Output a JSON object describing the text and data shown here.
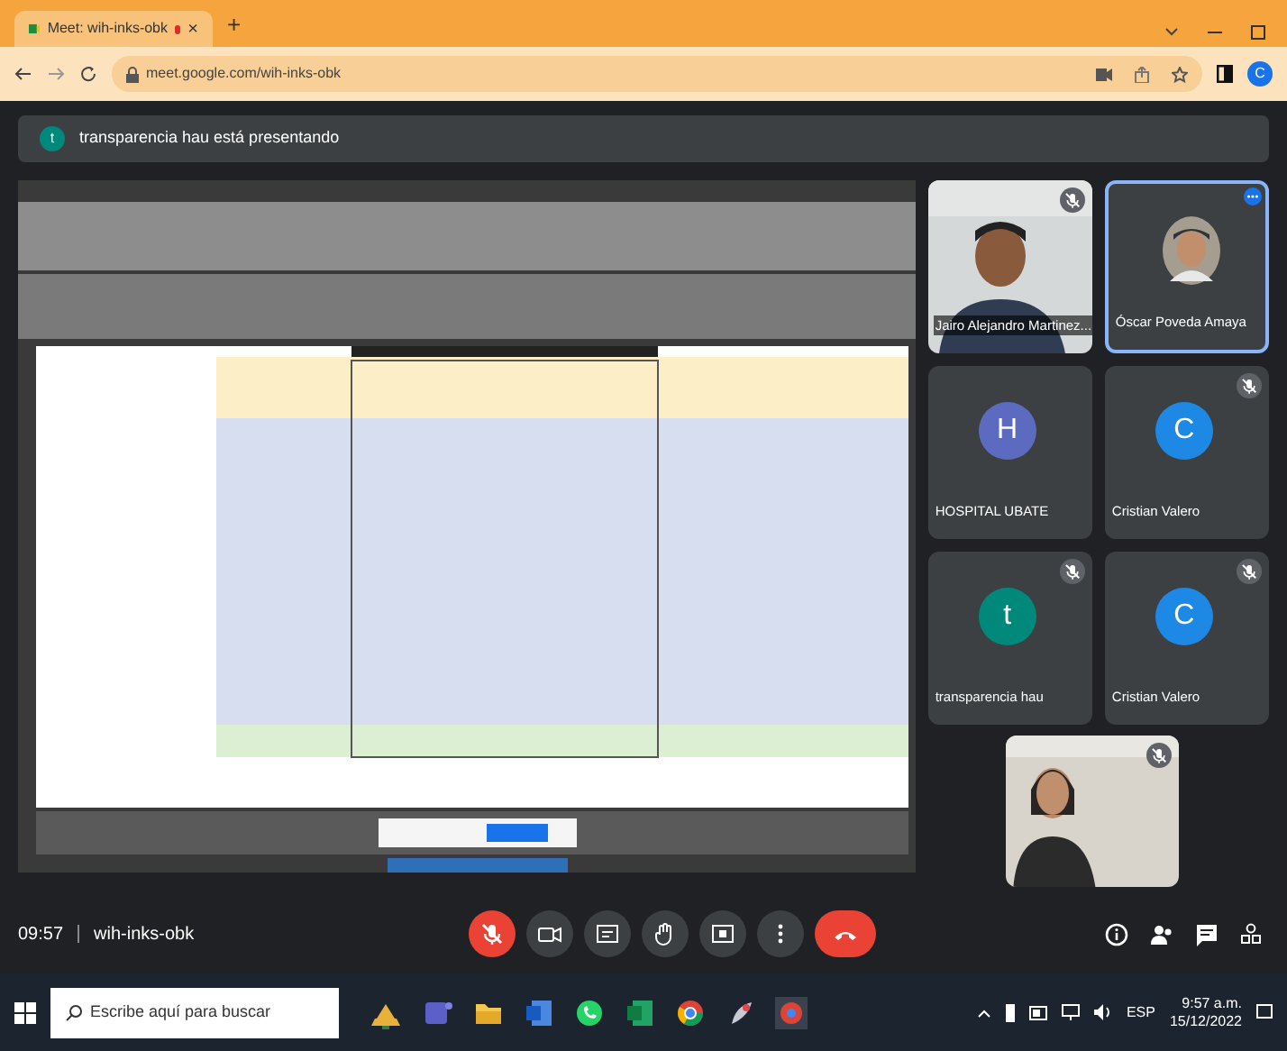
{
  "browser": {
    "tab_title": "Meet: wih-inks-obk",
    "tab_close": "×",
    "new_tab": "+",
    "url": "meet.google.com/wih-inks-obk",
    "profile_letter": "C"
  },
  "banner": {
    "avatar_letter": "t",
    "text": "transparencia hau está presentando"
  },
  "participants": [
    {
      "kind": "video",
      "name": "Jairo Alejandro Martinez...",
      "muted": true,
      "highlighted": false
    },
    {
      "name": "Óscar Poveda Amaya",
      "muted": false,
      "highlighted": true
    },
    {
      "kind": "avatar",
      "letter": "H",
      "color": "#5c6bc0",
      "name": "HOSPITAL UBATE",
      "muted": false,
      "highlighted": false
    },
    {
      "kind": "avatar",
      "letter": "C",
      "color": "#1e88e5",
      "name": "Cristian Valero",
      "muted": true,
      "highlighted": false
    },
    {
      "kind": "avatar",
      "letter": "t",
      "color": "#00897b",
      "name": "transparencia hau",
      "muted": true,
      "highlighted": false
    },
    {
      "kind": "avatar",
      "letter": "C",
      "color": "#1e88e5",
      "name": "Cristian Valero",
      "muted": true,
      "highlighted": false
    }
  ],
  "self_view": {
    "muted": true
  },
  "meeting_bar": {
    "time": "09:57",
    "code": "wih-inks-obk",
    "controls": [
      {
        "kind": "mic",
        "on": false
      },
      {
        "kind": "camera"
      },
      {
        "kind": "captions"
      },
      {
        "kind": "hand"
      },
      {
        "kind": "present"
      },
      {
        "kind": "more"
      },
      {
        "kind": "hangup"
      }
    ]
  },
  "taskbar": {
    "search_placeholder": "Escribe aquí para buscar",
    "language": "ESP",
    "clock": "9:57 a.m.",
    "date": "15/12/2022"
  }
}
